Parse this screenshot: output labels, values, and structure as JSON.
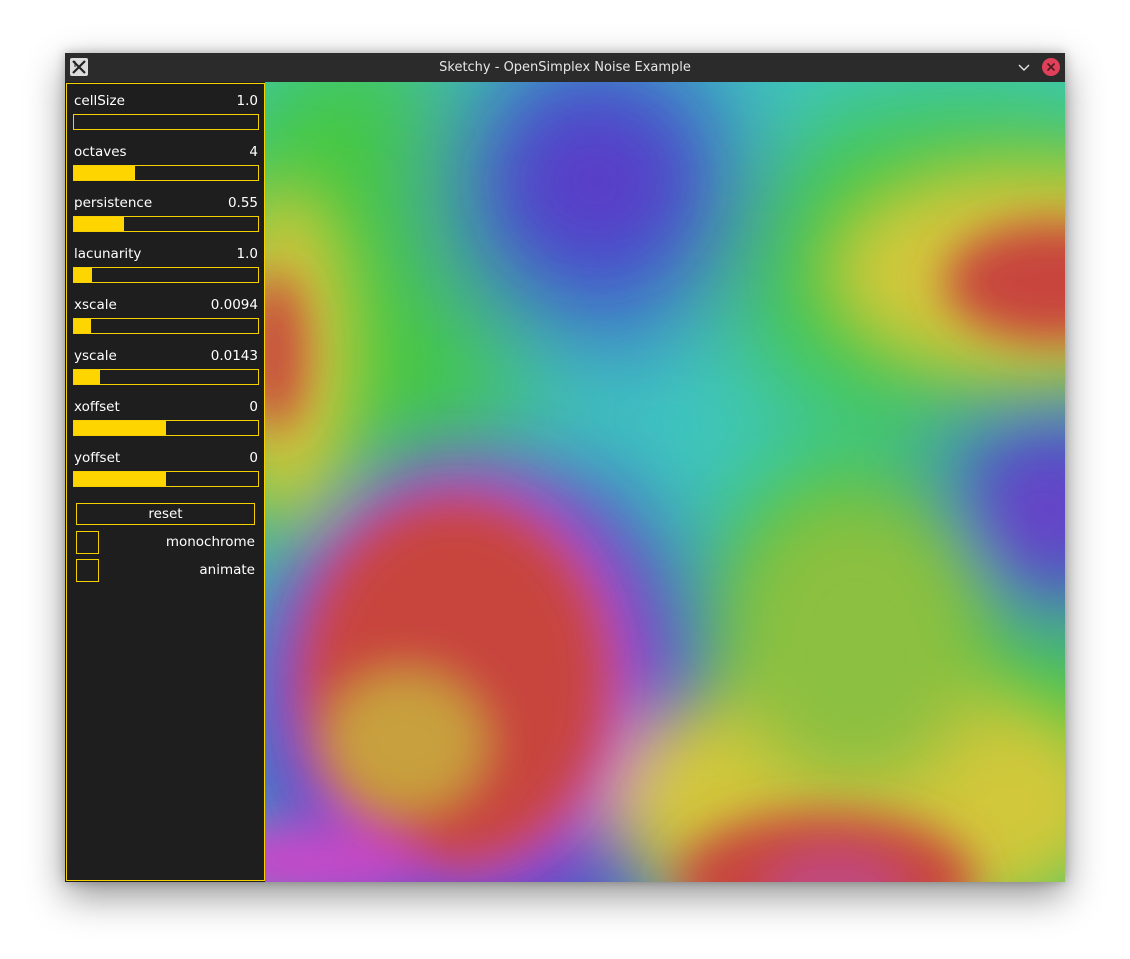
{
  "window": {
    "title": "Sketchy - OpenSimplex Noise Example",
    "app_icon": "x-logo-icon",
    "controls": [
      "chevron-down-icon",
      "close-icon"
    ],
    "colors": {
      "accent": "#ffd500",
      "panel_bg": "#1e1e1e",
      "titlebar_bg": "#2b2b2b",
      "close": "#e0405a"
    }
  },
  "controls": {
    "sliders": [
      {
        "label": "cellSize",
        "value": "1.0",
        "fraction": 0.0
      },
      {
        "label": "octaves",
        "value": "4",
        "fraction": 0.33
      },
      {
        "label": "persistence",
        "value": "0.55",
        "fraction": 0.27
      },
      {
        "label": "lacunarity",
        "value": "1.0",
        "fraction": 0.1
      },
      {
        "label": "xscale",
        "value": "0.0094",
        "fraction": 0.09
      },
      {
        "label": "yscale",
        "value": "0.0143",
        "fraction": 0.14
      },
      {
        "label": "xoffset",
        "value": "0",
        "fraction": 0.5
      },
      {
        "label": "yoffset",
        "value": "0",
        "fraction": 0.5
      }
    ],
    "reset_label": "reset",
    "checkboxes": [
      {
        "label": "monochrome",
        "checked": false
      },
      {
        "label": "animate",
        "checked": false
      }
    ]
  }
}
